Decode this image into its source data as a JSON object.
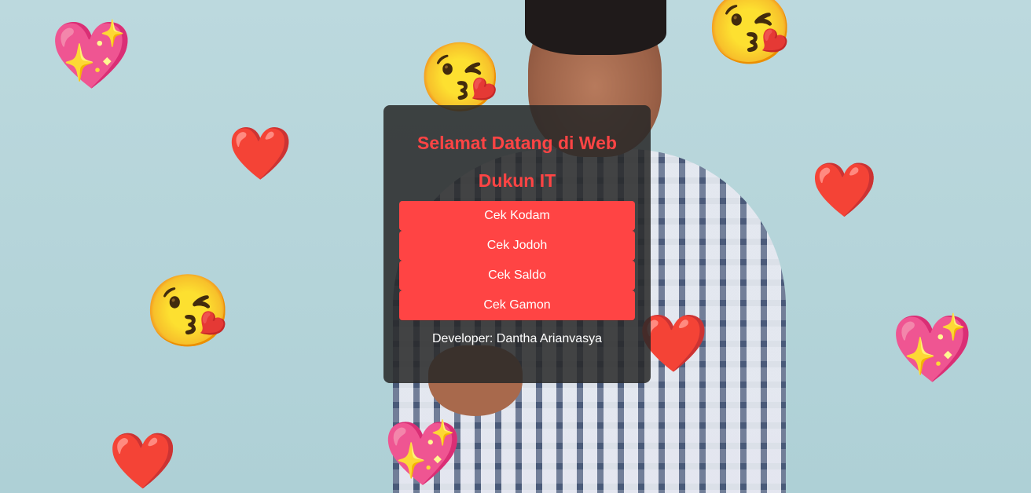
{
  "header": {
    "title": "Selamat Datang di Web Dukun IT"
  },
  "menu": {
    "items": [
      {
        "label": "Cek Kodam"
      },
      {
        "label": "Cek Jodoh"
      },
      {
        "label": "Cek Saldo"
      },
      {
        "label": "Cek Gamon"
      }
    ]
  },
  "footer": {
    "developer": "Developer: Dantha Arianvasya"
  },
  "decorations": {
    "sparkling_heart": "💖",
    "red_heart": "❤️",
    "kiss_face": "😘"
  },
  "colors": {
    "accent": "#ff4444",
    "panel_bg": "#282828",
    "button_text": "#ffffff"
  }
}
